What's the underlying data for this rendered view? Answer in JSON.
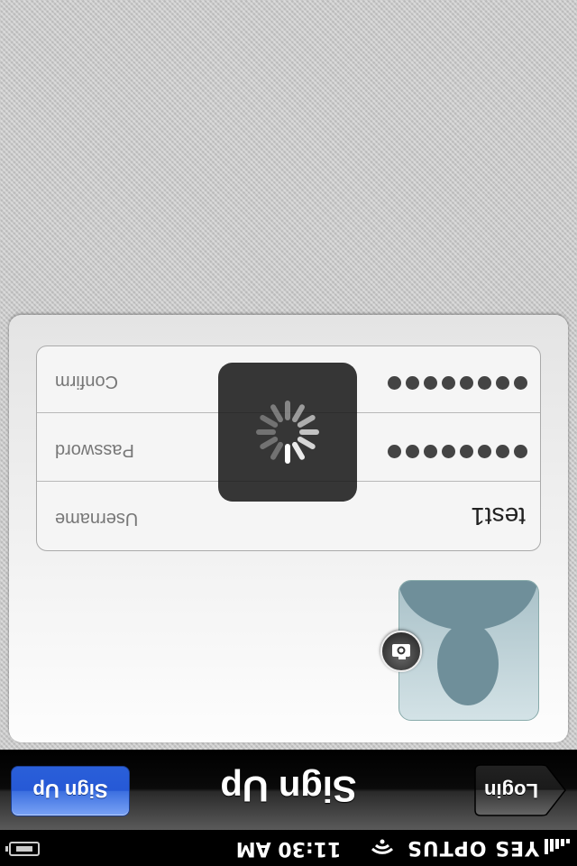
{
  "status_bar": {
    "carrier": "YES OPTUS",
    "time": "11:30 AM",
    "icons": [
      "signal-icon",
      "wifi-icon",
      "battery-charging-icon"
    ]
  },
  "nav": {
    "title": "Sign Up",
    "back_label": "Login",
    "action_label": "Sign Up"
  },
  "form": {
    "photo_icon": "camera-icon",
    "fields": [
      {
        "label": "Username",
        "value": "test1"
      },
      {
        "label": "Password",
        "value": "",
        "masked_length": 8
      },
      {
        "label": "Confirm",
        "value": "",
        "masked_length": 8
      }
    ]
  },
  "loading_icon": "spinner-icon",
  "colors": {
    "action_blue": "#2a5fd9",
    "navbar": "#000000",
    "background": "#c8c8c8"
  }
}
